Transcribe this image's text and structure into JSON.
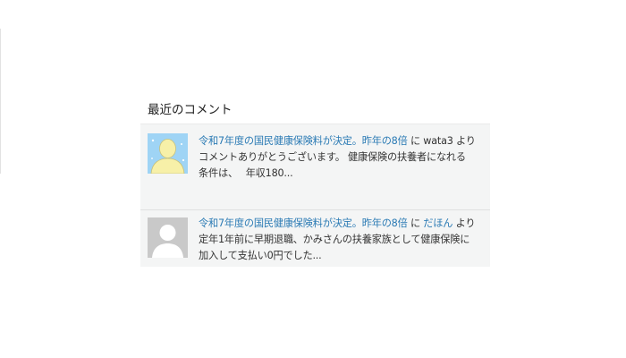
{
  "widget": {
    "title": "最近のコメント"
  },
  "comments": [
    {
      "post_title": "令和7年度の国民健康保険料が決定。昨年の8倍",
      "connector": " に ",
      "author": "wata3",
      "suffix": " より",
      "excerpt_line1": "コメントありがとうございます。 健康保険の扶養者になれる",
      "excerpt_line2": "条件は、　 年収180...",
      "avatar_icon": "custom-avatar-icon"
    },
    {
      "post_title": "令和7年度の国民健康保険料が決定。昨年の8倍",
      "connector": " に ",
      "author": "だほん",
      "suffix": " より",
      "excerpt_line1": "定年1年前に早期退職、かみさんの扶養家族として健康保険に",
      "excerpt_line2": "加入して支払い0円でした...",
      "avatar_icon": "default-avatar-icon"
    }
  ],
  "colors": {
    "link": "#2a7ab4",
    "text": "#333333",
    "item_background": "#f4f5f5"
  }
}
